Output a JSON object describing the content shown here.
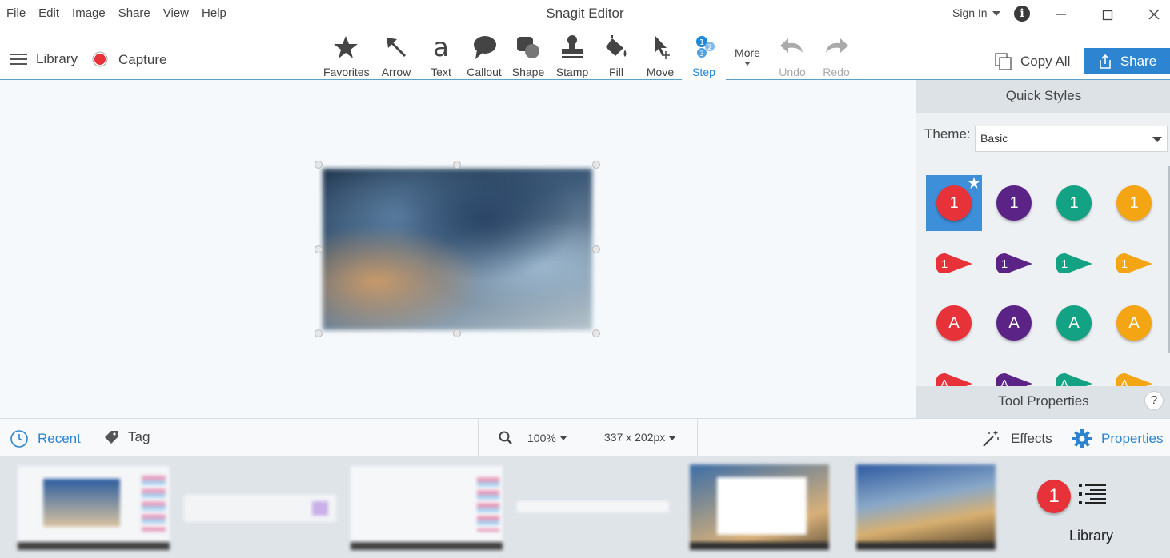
{
  "app": {
    "title": "Snagit Editor"
  },
  "menu": [
    "File",
    "Edit",
    "Image",
    "Share",
    "View",
    "Help"
  ],
  "account": {
    "sign_in": "Sign In"
  },
  "toolbar": {
    "library": "Library",
    "capture": "Capture",
    "tools": [
      {
        "label": "Favorites",
        "icon": "star-icon"
      },
      {
        "label": "Arrow",
        "icon": "arrow-icon"
      },
      {
        "label": "Text",
        "icon": "text-icon"
      },
      {
        "label": "Callout",
        "icon": "callout-icon"
      },
      {
        "label": "Shape",
        "icon": "shape-icon"
      },
      {
        "label": "Stamp",
        "icon": "stamp-icon"
      },
      {
        "label": "Fill",
        "icon": "fill-icon"
      },
      {
        "label": "Move",
        "icon": "move-icon"
      },
      {
        "label": "Step",
        "icon": "step-icon",
        "active": true
      }
    ],
    "more": "More",
    "undo": "Undo",
    "redo": "Redo",
    "copy_all": "Copy All",
    "share": "Share"
  },
  "quick_styles": {
    "title": "Quick Styles",
    "theme_label": "Theme:",
    "theme_value": "Basic",
    "colors": [
      "#e8323a",
      "#5b2385",
      "#13a283",
      "#f3a514"
    ],
    "rows": [
      {
        "kind": "circle",
        "text": "1"
      },
      {
        "kind": "pin",
        "text": "1"
      },
      {
        "kind": "circle",
        "text": "A"
      },
      {
        "kind": "pin",
        "text": "A"
      }
    ]
  },
  "tool_properties": {
    "title": "Tool Properties",
    "help": "?"
  },
  "status": {
    "recent": "Recent",
    "tag": "Tag",
    "zoom": "100%",
    "dimensions": "337 x 202px",
    "effects": "Effects",
    "properties": "Properties"
  },
  "tray": {
    "library_label": "Library",
    "badge": "1"
  },
  "colors": {
    "accent": "#2d84d0",
    "step_red": "#e8323a"
  }
}
